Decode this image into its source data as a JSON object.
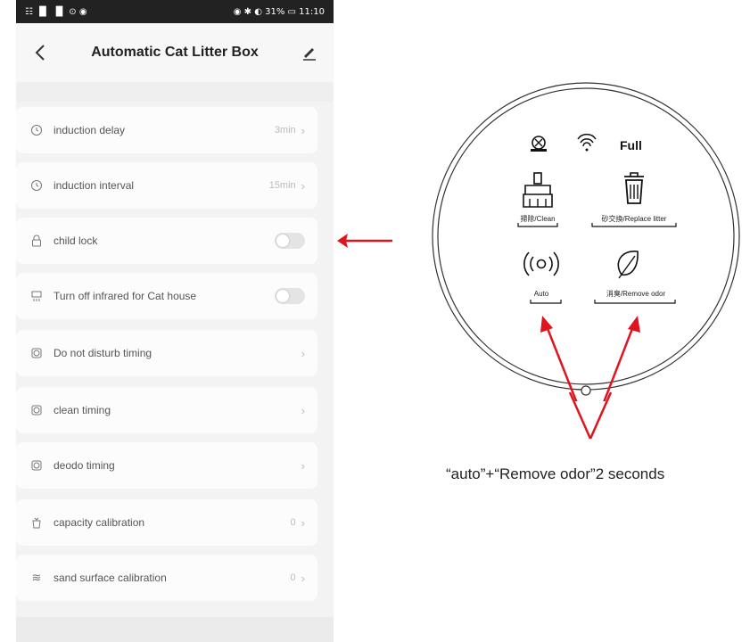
{
  "status_bar": {
    "left": "☷ ▐▌ ▐▌ ⊙ ◉",
    "right": "◉ ✱ ◐ 31% ▭ 11:10"
  },
  "header": {
    "title": "Automatic Cat Litter Box",
    "back_icon": "chevron-left-icon",
    "edit_icon": "pencil-icon"
  },
  "settings": [
    {
      "label": "induction delay",
      "value": "3min",
      "control": "chevron",
      "icon": "clock-icon"
    },
    {
      "label": "induction interval",
      "value": "15min",
      "control": "chevron",
      "icon": "clock-icon"
    },
    {
      "label": "child lock",
      "value": "",
      "control": "toggle",
      "toggle_on": false,
      "icon": "lock-icon"
    },
    {
      "label": "Turn off infrared for Cat house",
      "value": "",
      "control": "toggle",
      "toggle_on": false,
      "icon": "infrared-icon"
    },
    {
      "label": "Do not disturb timing",
      "value": "",
      "control": "chevron",
      "icon": "alarm-icon"
    },
    {
      "label": "clean timing",
      "value": "",
      "control": "chevron",
      "icon": "alarm-icon"
    },
    {
      "label": "deodo timing",
      "value": "",
      "control": "chevron",
      "icon": "alarm-icon"
    },
    {
      "label": "capacity calibration",
      "value": "0",
      "control": "chevron",
      "icon": "capacity-icon"
    },
    {
      "label": "sand surface calibration",
      "value": "0",
      "control": "chevron",
      "icon": "wave-icon"
    }
  ],
  "device_panel": {
    "status_text": "Full",
    "buttons": [
      {
        "label": "掃除/Clean",
        "icon": "broom-icon"
      },
      {
        "label": "砂交換/Replace litter",
        "icon": "trash-icon"
      },
      {
        "label": "Auto",
        "icon": "signal-icon"
      },
      {
        "label": "消臭/Remove odor",
        "icon": "leaf-icon"
      }
    ]
  },
  "instruction": "“auto”+“Remove odor”2 seconds",
  "colors": {
    "arrow": "#e0141e",
    "accent_text": "#222222"
  }
}
